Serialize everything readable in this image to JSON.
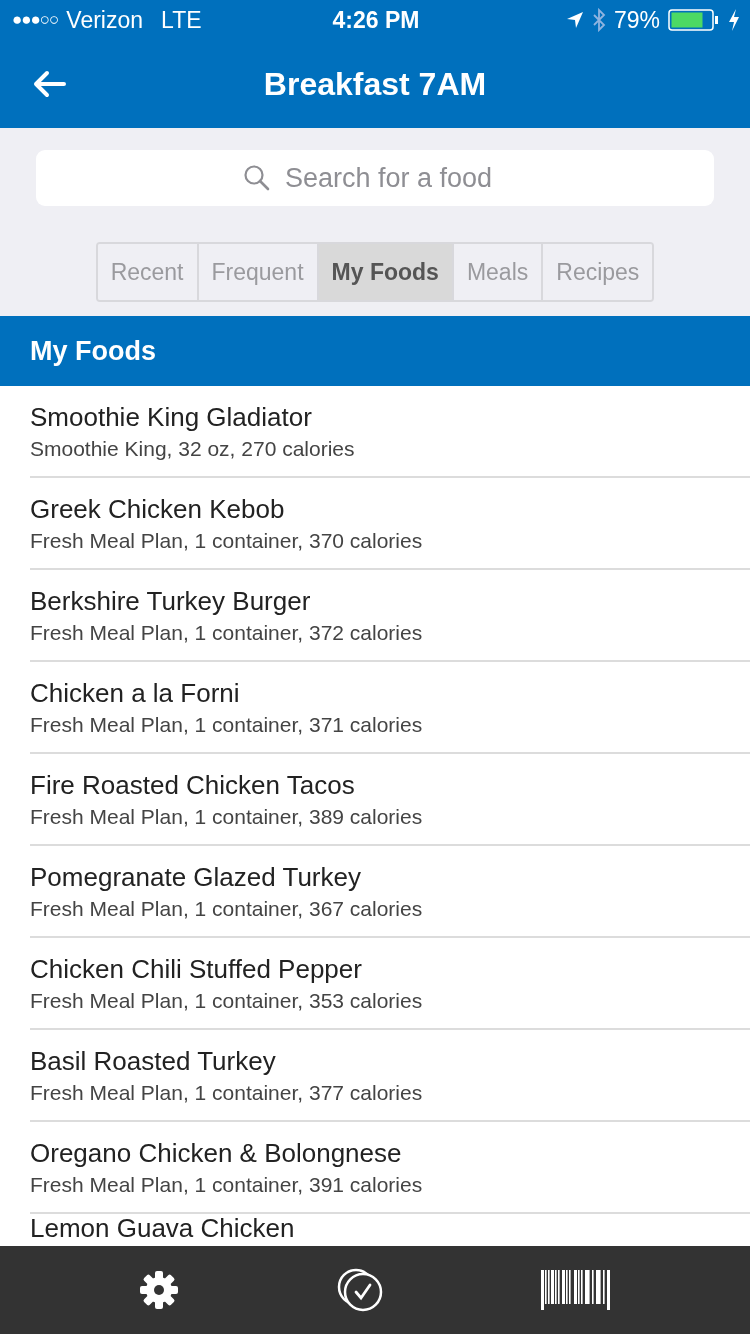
{
  "status_bar": {
    "signal_dots": "●●●○○",
    "carrier": "Verizon",
    "network": "LTE",
    "time": "4:26 PM",
    "battery": "79%"
  },
  "nav": {
    "title": "Breakfast 7AM"
  },
  "search": {
    "placeholder": "Search for a food"
  },
  "tabs": [
    {
      "label": "Recent",
      "selected": false
    },
    {
      "label": "Frequent",
      "selected": false
    },
    {
      "label": "My Foods",
      "selected": true
    },
    {
      "label": "Meals",
      "selected": false
    },
    {
      "label": "Recipes",
      "selected": false
    }
  ],
  "section": {
    "title": "My Foods"
  },
  "foods": [
    {
      "name": "Smoothie King Gladiator",
      "detail": "Smoothie King, 32 oz, 270 calories"
    },
    {
      "name": "Greek Chicken Kebob",
      "detail": "Fresh Meal Plan, 1 container, 370 calories"
    },
    {
      "name": "Berkshire Turkey Burger",
      "detail": "Fresh Meal Plan, 1 container, 372 calories"
    },
    {
      "name": "Chicken a la Forni",
      "detail": "Fresh Meal Plan, 1 container, 371 calories"
    },
    {
      "name": "Fire Roasted Chicken Tacos",
      "detail": "Fresh Meal Plan, 1 container, 389 calories"
    },
    {
      "name": "Pomegranate Glazed Turkey",
      "detail": "Fresh Meal Plan, 1 container, 367 calories"
    },
    {
      "name": "Chicken Chili Stuffed Pepper",
      "detail": "Fresh Meal Plan, 1 container, 353 calories"
    },
    {
      "name": "Basil Roasted Turkey",
      "detail": "Fresh Meal Plan, 1 container, 377 calories"
    },
    {
      "name": "Oregano Chicken & Bolongnese",
      "detail": "Fresh Meal Plan, 1 container, 391 calories"
    },
    {
      "name": "Lemon Guava Chicken"
    }
  ]
}
